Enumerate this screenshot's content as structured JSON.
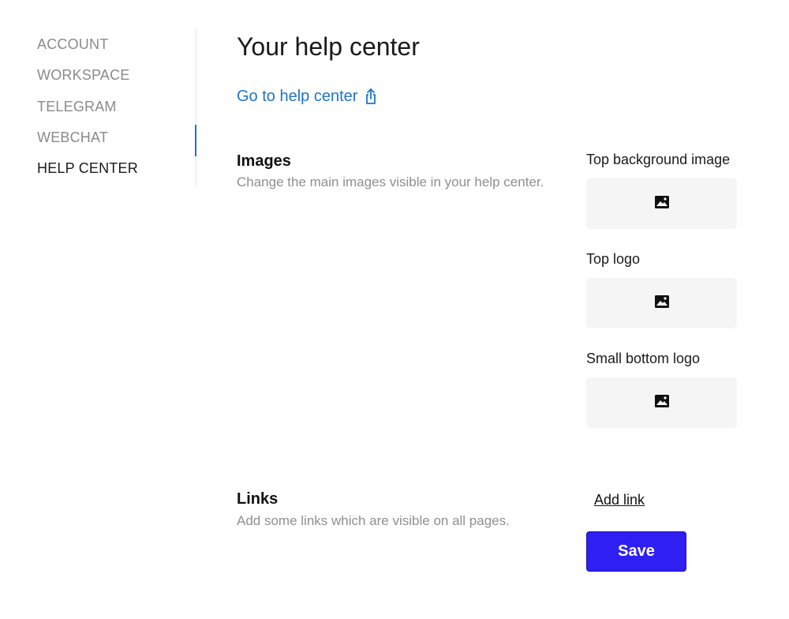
{
  "sidebar": {
    "items": [
      {
        "label": "ACCOUNT",
        "active": false
      },
      {
        "label": "WORKSPACE",
        "active": false
      },
      {
        "label": "TELEGRAM",
        "active": false
      },
      {
        "label": "WEBCHAT",
        "active": false
      },
      {
        "label": "HELP CENTER",
        "active": true
      }
    ],
    "active_color": "#1d6fd8"
  },
  "main": {
    "title": "Your help center",
    "help_link": {
      "label": "Go to help center",
      "icon": "share-up-icon",
      "color": "#1d73c9"
    },
    "images_section": {
      "title": "Images",
      "description": "Change the main images visible in your help center.",
      "fields": [
        {
          "label": "Top background image",
          "icon": "image-icon"
        },
        {
          "label": "Top logo",
          "icon": "image-icon"
        },
        {
          "label": "Small bottom logo",
          "icon": "image-icon"
        }
      ]
    },
    "links_section": {
      "title": "Links",
      "description": "Add some links which are visible on all pages.",
      "add_link_label": "Add link"
    },
    "save_label": "Save",
    "save_color": "#2f1ff2"
  }
}
